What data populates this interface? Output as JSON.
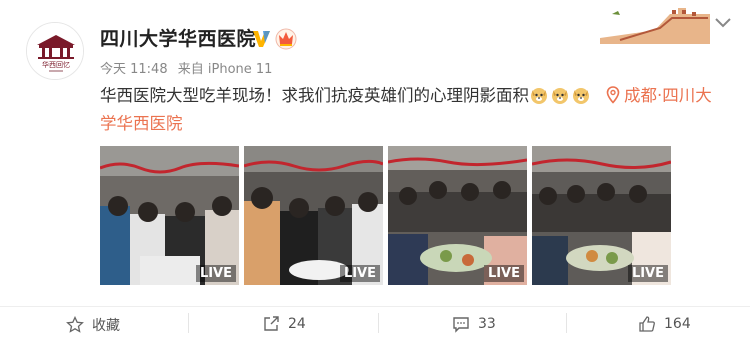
{
  "post": {
    "author": "四川大学华西医院",
    "time": "今天 11:48",
    "source": "来自 iPhone 11",
    "text_main": "华西医院大型吃羊现场！求我们抗疫英雄们的心理阴影面积",
    "location": "成都·四川大学华西医院",
    "avatar_caption": "华西回忆",
    "emoji_icon": "doge-emoji",
    "photo_badge": "LIVE"
  },
  "actions": {
    "favorite_label": "收藏",
    "repost_count": "24",
    "comment_count": "33",
    "like_count": "164"
  },
  "colors": {
    "location": "#eb7350",
    "verified": "#ffb400",
    "vip": "#f35b3c"
  }
}
